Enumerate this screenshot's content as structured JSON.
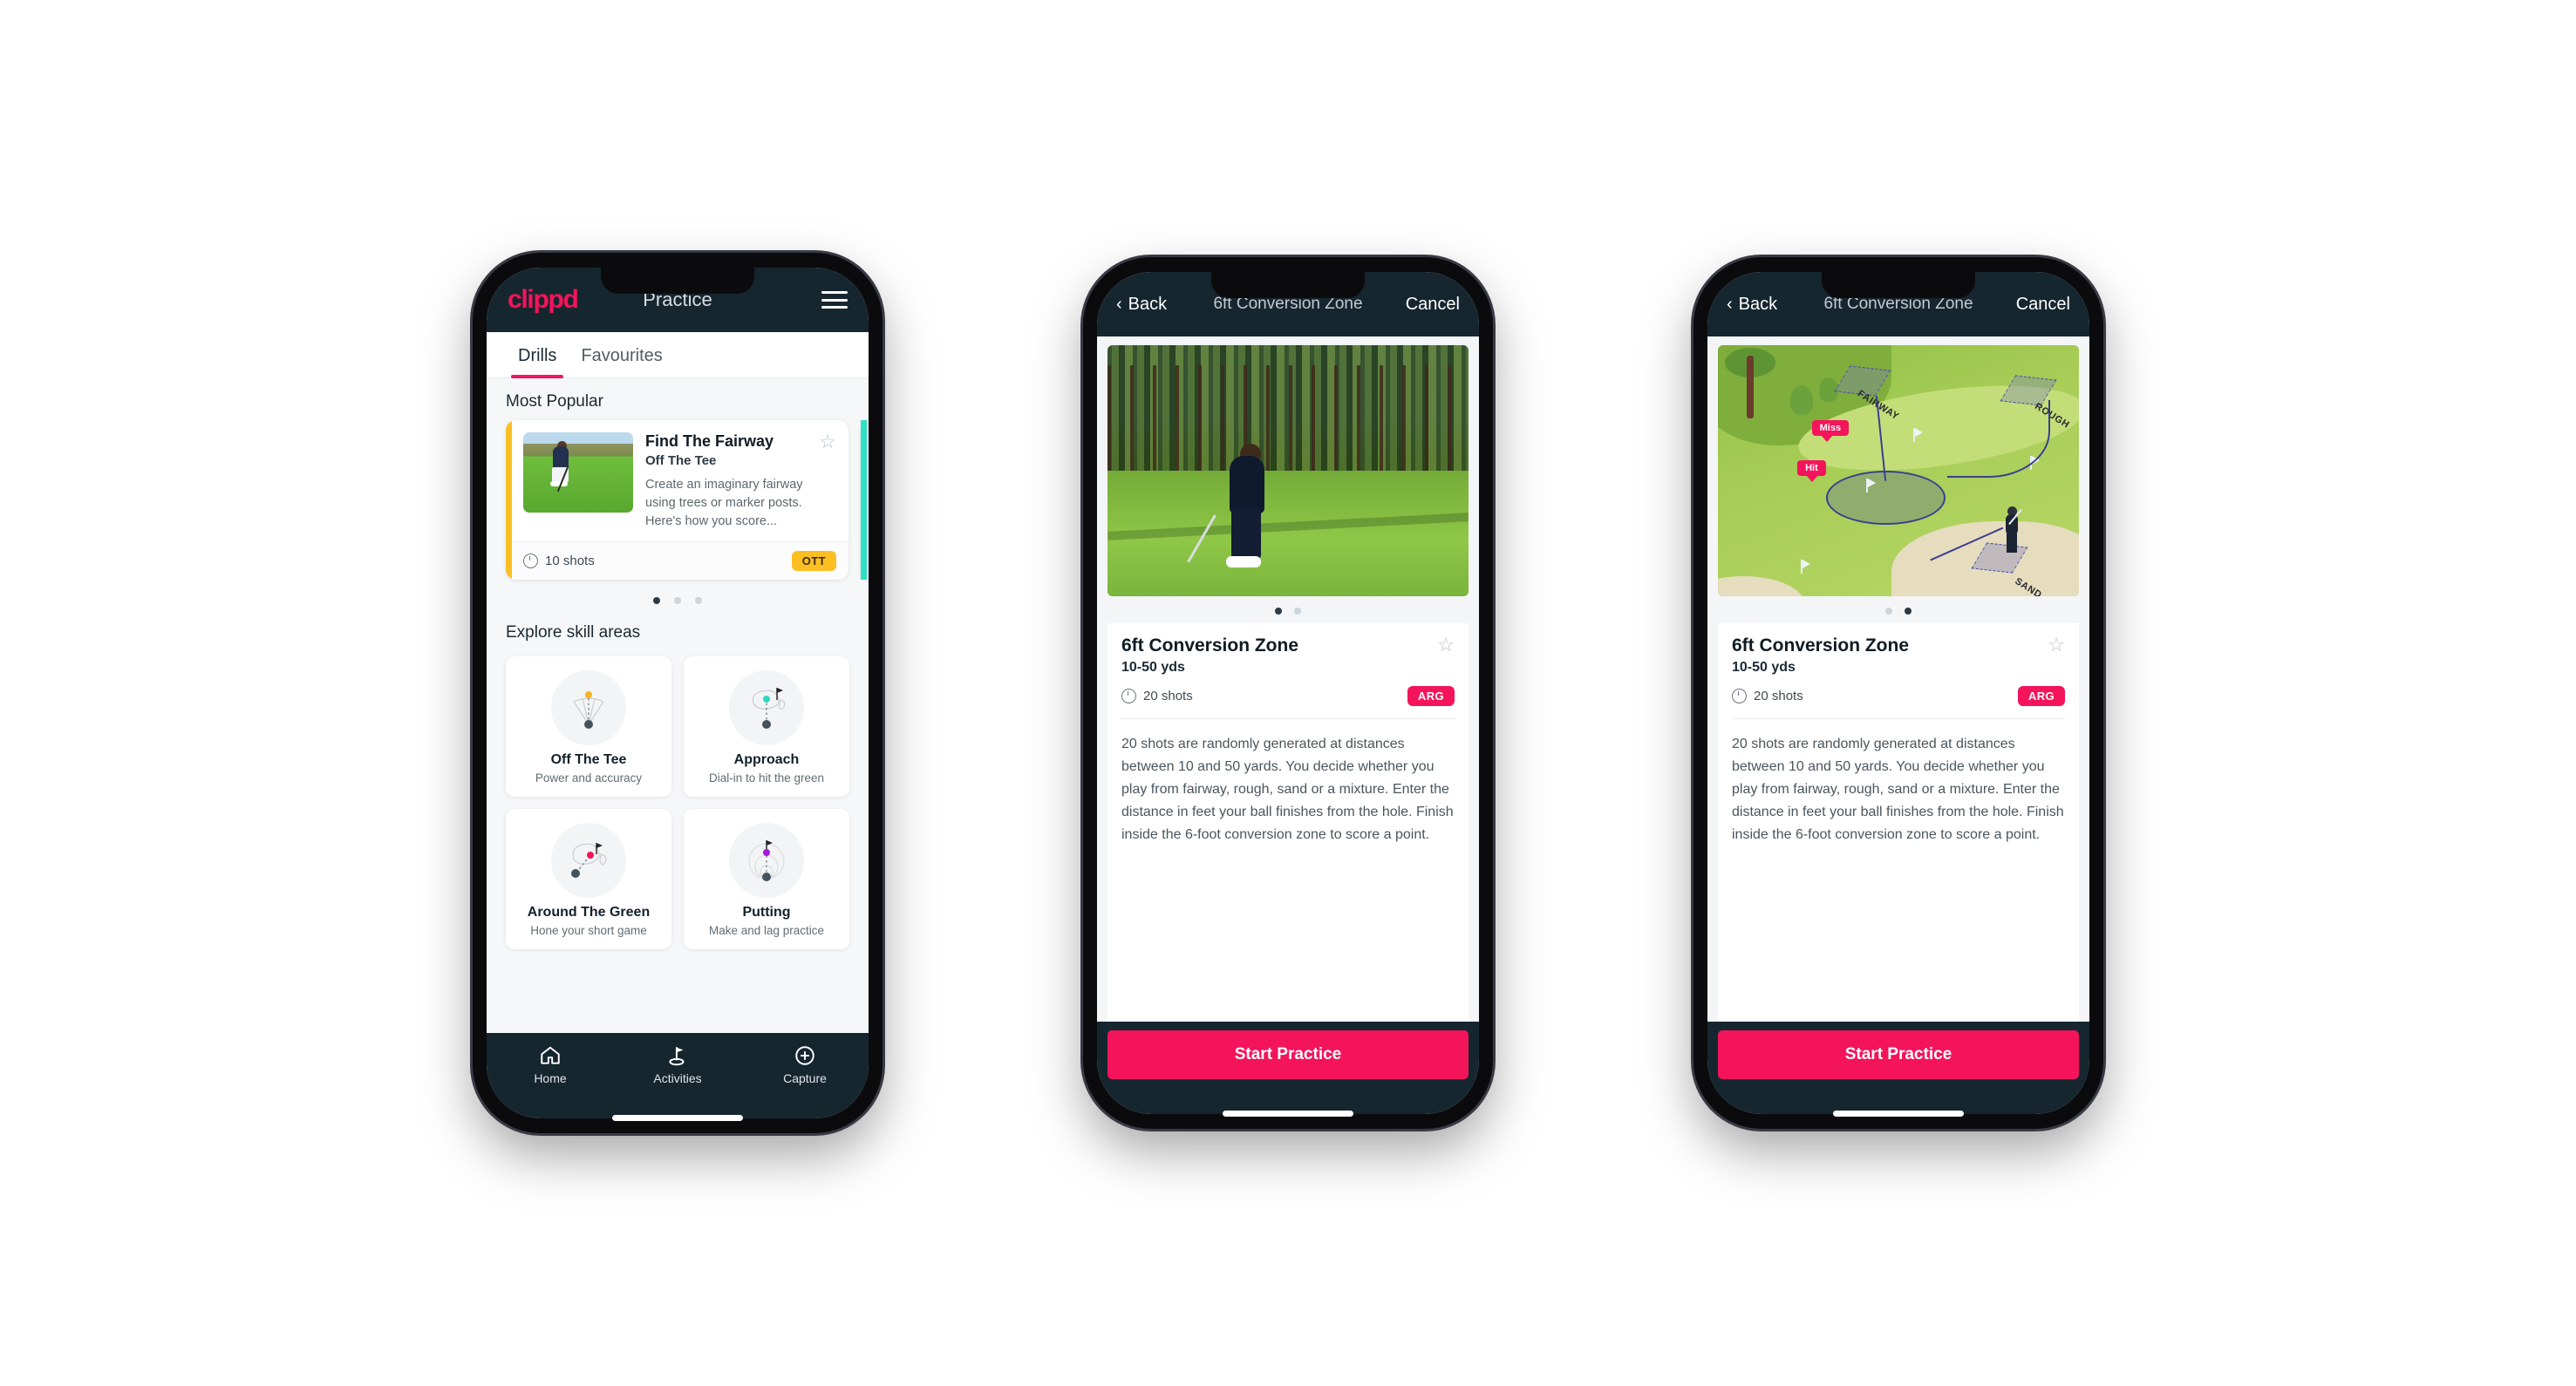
{
  "colors": {
    "brand": "#f4145b",
    "header": "#16262f",
    "ott": "#fbbf24",
    "arg": "#f4145b",
    "teal": "#2fe0c4"
  },
  "phone1": {
    "header": {
      "brand": "clippd",
      "title": "Practice",
      "menu_icon": "hamburger-menu-icon"
    },
    "tabs": [
      {
        "label": "Drills",
        "active": true
      },
      {
        "label": "Favourites",
        "active": false
      }
    ],
    "most_popular": {
      "section_label": "Most Popular",
      "card": {
        "title": "Find The Fairway",
        "subtitle": "Off The Tee",
        "description": "Create an imaginary fairway using trees or marker posts. Here's how you score...",
        "shots": "10 shots",
        "badge": "OTT",
        "star_icon": "star-outline-icon",
        "clock_icon": "clock-icon"
      },
      "dots": [
        true,
        false,
        false
      ]
    },
    "skill_areas": {
      "section_label": "Explore skill areas",
      "items": [
        {
          "name": "Off The Tee",
          "desc": "Power and accuracy",
          "icon": "tee-fan-icon"
        },
        {
          "name": "Approach",
          "desc": "Dial-in to hit the green",
          "icon": "approach-green-icon"
        },
        {
          "name": "Around The Green",
          "desc": "Hone your short game",
          "icon": "chip-green-icon"
        },
        {
          "name": "Putting",
          "desc": "Make and lag practice",
          "icon": "putting-rings-icon"
        }
      ]
    },
    "nav": [
      {
        "label": "Home",
        "icon": "home-icon",
        "active": false
      },
      {
        "label": "Activities",
        "icon": "golf-flag-icon",
        "active": true
      },
      {
        "label": "Capture",
        "icon": "plus-circle-icon",
        "active": false
      }
    ]
  },
  "phone2": {
    "header": {
      "back": "Back",
      "title": "6ft Conversion Zone",
      "cancel": "Cancel",
      "back_icon": "chevron-left-icon"
    },
    "media": {
      "type": "photo",
      "alt": "golfer-chipping-photo"
    },
    "dots": [
      true,
      false
    ],
    "info": {
      "title": "6ft Conversion Zone",
      "subtitle": "10-50 yds",
      "shots": "20 shots",
      "badge": "ARG",
      "star_icon": "star-outline-icon",
      "clock_icon": "clock-icon",
      "description": "20 shots are randomly generated at distances between 10 and 50 yards. You decide whether you play from fairway, rough, sand or a mixture. Enter the distance in feet your ball finishes from the hole. Finish inside the 6-foot conversion zone to score a point."
    },
    "cta": "Start Practice"
  },
  "phone3": {
    "header": {
      "back": "Back",
      "title": "6ft Conversion Zone",
      "cancel": "Cancel",
      "back_icon": "chevron-left-icon"
    },
    "media": {
      "type": "illustration",
      "alt": "golf-hole-diagram",
      "zone_labels": [
        "FAIRWAY",
        "ROUGH",
        "SAND"
      ],
      "tags": [
        "Miss",
        "Hit"
      ]
    },
    "dots": [
      false,
      true
    ],
    "info": {
      "title": "6ft Conversion Zone",
      "subtitle": "10-50 yds",
      "shots": "20 shots",
      "badge": "ARG",
      "star_icon": "star-outline-icon",
      "clock_icon": "clock-icon",
      "description": "20 shots are randomly generated at distances between 10 and 50 yards. You decide whether you play from fairway, rough, sand or a mixture. Enter the distance in feet your ball finishes from the hole. Finish inside the 6-foot conversion zone to score a point."
    },
    "cta": "Start Practice"
  }
}
